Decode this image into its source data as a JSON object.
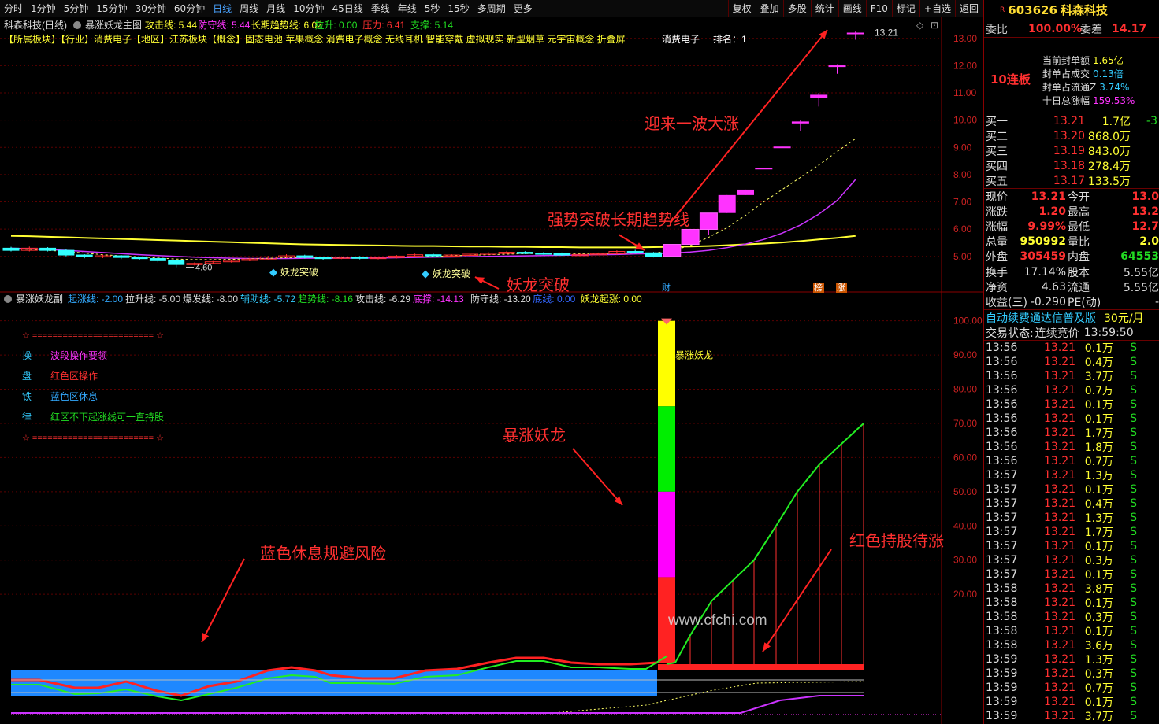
{
  "toolbar": {
    "items": [
      "分时",
      "1分钟",
      "5分钟",
      "15分钟",
      "30分钟",
      "60分钟",
      "日线",
      "周线",
      "月线",
      "10分钟",
      "45日线",
      "季线",
      "年线",
      "5秒",
      "15秒",
      "多周期",
      "更多"
    ],
    "active": "日线",
    "right": [
      "复权",
      "叠加",
      "多股",
      "统计",
      "画线",
      "F10",
      "标记",
      "+自选",
      "返回"
    ]
  },
  "main": {
    "header_name": "科森科技(日线)",
    "header_indicator": "暴涨妖龙主图",
    "params": [
      {
        "t": "攻击线: 5.44",
        "c": "#ffff33"
      },
      {
        "t": "防守线: 5.44",
        "c": "#ff33ff"
      },
      {
        "t": "长期趋势线: 6.02",
        "c": "#ffff33"
      },
      {
        "t": "拉升: 0.00",
        "c": "#22dd22"
      },
      {
        "t": "压力: 6.41",
        "c": "#ff3030"
      },
      {
        "t": "支撑: 5.14",
        "c": "#22dd22"
      }
    ],
    "concepts": "【所属板块】【行业】消费电子【地区】江苏板块【概念】固态电池 苹果概念 消费电子概念 无线耳机 智能穿戴 虚拟现实 新型烟草 元宇宙概念 折叠屏",
    "sector": "消费电子",
    "rank_label": "排名：1",
    "high_label": "13.21",
    "low_label": "4.60",
    "markers": [
      "财",
      "榜",
      "涨"
    ],
    "signals": [
      "妖龙突破",
      "妖龙突破"
    ],
    "annotations": [
      "迎来一波大涨",
      "强势突破长期趋势线",
      "妖龙突破"
    ]
  },
  "chart_data": [
    {
      "type": "candlestick",
      "title": "科森科技(日线)",
      "ylim": [
        4.3,
        13.6
      ],
      "yticks": [
        5.0,
        6.0,
        7.0,
        8.0,
        9.0,
        10.0,
        11.0,
        12.0,
        13.0
      ],
      "candles": [
        [
          5.3,
          5.22,
          5.35,
          5.18
        ],
        [
          5.22,
          5.3,
          5.36,
          5.18
        ],
        [
          5.3,
          5.22,
          5.34,
          5.18
        ],
        [
          5.22,
          5.05,
          5.26,
          5.0
        ],
        [
          5.05,
          4.98,
          5.08,
          4.93
        ],
        [
          4.98,
          5.02,
          5.06,
          4.94
        ],
        [
          5.02,
          4.96,
          5.05,
          4.9
        ],
        [
          4.96,
          4.92,
          4.99,
          4.86
        ],
        [
          4.92,
          4.84,
          4.95,
          4.78
        ],
        [
          4.84,
          4.7,
          4.88,
          4.6
        ],
        [
          4.7,
          4.74,
          4.78,
          4.66
        ],
        [
          4.74,
          4.8,
          4.83,
          4.71
        ],
        [
          4.8,
          4.85,
          4.88,
          4.77
        ],
        [
          4.85,
          4.9,
          4.94,
          4.82
        ],
        [
          4.9,
          4.98,
          5.02,
          4.88
        ],
        [
          4.98,
          5.02,
          5.08,
          4.94
        ],
        [
          5.02,
          4.96,
          5.06,
          4.92
        ],
        [
          4.96,
          4.94,
          4.99,
          4.88
        ],
        [
          4.94,
          4.97,
          5.0,
          4.9
        ],
        [
          4.97,
          4.93,
          5.01,
          4.89
        ],
        [
          4.93,
          4.96,
          4.99,
          4.89
        ],
        [
          4.96,
          5.01,
          5.05,
          4.92
        ],
        [
          5.01,
          5.06,
          5.1,
          4.98
        ],
        [
          5.06,
          5.02,
          5.1,
          4.98
        ],
        [
          5.02,
          5.05,
          5.08,
          4.98
        ],
        [
          5.05,
          5.08,
          5.12,
          5.02
        ],
        [
          5.08,
          5.12,
          5.16,
          5.04
        ],
        [
          5.12,
          5.15,
          5.2,
          5.08
        ],
        [
          5.15,
          5.12,
          5.19,
          5.08
        ],
        [
          5.12,
          5.1,
          5.15,
          5.06
        ],
        [
          5.1,
          5.05,
          5.14,
          5.02
        ],
        [
          5.05,
          5.07,
          5.1,
          5.02
        ],
        [
          5.07,
          5.1,
          5.14,
          5.04
        ],
        [
          5.1,
          5.18,
          5.22,
          5.06
        ],
        [
          5.18,
          5.13,
          5.24,
          5.1
        ],
        [
          5.13,
          5.0,
          5.16,
          4.96
        ],
        [
          5.0,
          5.44,
          5.44,
          4.98
        ],
        [
          5.44,
          5.99,
          5.99,
          5.44
        ],
        [
          5.99,
          6.59,
          6.59,
          5.8
        ],
        [
          6.59,
          7.25,
          7.25,
          6.59
        ],
        [
          7.25,
          7.45,
          7.45,
          7.25
        ],
        [
          8.2,
          8.25,
          8.25,
          8.2
        ],
        [
          8.99,
          9.03,
          9.03,
          8.99
        ],
        [
          9.88,
          9.95,
          10.0,
          9.6
        ],
        [
          10.8,
          10.93,
          11.0,
          10.5
        ],
        [
          11.95,
          12.01,
          12.05,
          11.7
        ],
        [
          13.21,
          13.21,
          13.25,
          12.95
        ]
      ],
      "series": [
        {
          "name": "长期趋势线",
          "value": 6.02
        },
        {
          "name": "攻击线",
          "value": 5.44
        },
        {
          "name": "防守线",
          "value": 5.44
        }
      ]
    },
    {
      "type": "indicator",
      "title": "暴涨妖龙副",
      "ylim": [
        0,
        102
      ],
      "yticks": [
        20,
        30,
        40,
        50,
        60,
        70,
        80,
        90,
        100
      ],
      "params": [
        {
          "t": "起涨线: -2.00",
          "c": "#33aaff"
        },
        {
          "t": "拉升线: -5.00",
          "c": "#ddd"
        },
        {
          "t": "爆发线: -8.00",
          "c": "#ddd"
        },
        {
          "t": "辅助线: -5.72",
          "c": "#33ccff"
        },
        {
          "t": "趋势线: -8.16",
          "c": "#22dd22"
        },
        {
          "t": "攻击线: -6.29",
          "c": "#ddd"
        },
        {
          "t": "底撑: -14.13",
          "c": "#ff33ff"
        },
        {
          "t": "防守线: -13.20",
          "c": "#ddd"
        },
        {
          "t": "底线: 0.00",
          "c": "#3366ff"
        },
        {
          "t": "妖龙起涨: 0.00",
          "c": "#ffff33"
        }
      ],
      "values": [
        0,
        0,
        0,
        0,
        0,
        0,
        0,
        0,
        0,
        0,
        0,
        0,
        0,
        0,
        0,
        0,
        0,
        0,
        0,
        0,
        0,
        0,
        0,
        0,
        0,
        0,
        0,
        0,
        0,
        0,
        0,
        0,
        0,
        0,
        0,
        100,
        8,
        18,
        30,
        40,
        50,
        58,
        64,
        70
      ],
      "legend_rows": [
        {
          "k": "操",
          "v": "波段操作要领"
        },
        {
          "k": "盘",
          "v": "红色区操作"
        },
        {
          "k": "铁",
          "v": "蓝色区休息"
        },
        {
          "k": "律",
          "v": "红区不下起涨线可一直持股"
        }
      ],
      "stars": "☆ ======================== ☆",
      "bar_label": "暴涨妖龙",
      "annotations": [
        "暴涨妖龙",
        "蓝色休息规避风险",
        "红色持股待涨"
      ],
      "watermark": "www.cfchi.com"
    }
  ],
  "quote": {
    "code": "603626",
    "name": "科森科技",
    "weibi_label": "委比",
    "weibi": "100.00%",
    "weicha_label": "委差",
    "weicha": "14.17",
    "lianban": "10连板",
    "seal": [
      {
        "l": "当前封单额",
        "v": "1.65亿",
        "c": "#ffff33"
      },
      {
        "l": "封单占成交",
        "v": "0.13倍",
        "c": "#33ccff"
      },
      {
        "l": "封单占流通Z",
        "v": "3.74%",
        "c": "#33ccff"
      },
      {
        "l": "十日总涨幅",
        "v": "159.53%",
        "c": "#ff33ff"
      }
    ],
    "book": [
      {
        "l": "买一",
        "p": "13.21",
        "v": "1.7亿",
        "x": "-3"
      },
      {
        "l": "买二",
        "p": "13.20",
        "v": "868.0万",
        "x": ""
      },
      {
        "l": "买三",
        "p": "13.19",
        "v": "843.0万",
        "x": ""
      },
      {
        "l": "买四",
        "p": "13.18",
        "v": "278.4万",
        "x": ""
      },
      {
        "l": "买五",
        "p": "13.17",
        "v": "133.5万",
        "x": ""
      }
    ],
    "stats": [
      {
        "a": "现价",
        "av": "13.21",
        "ac": "#ff3030",
        "b": "今开",
        "bv": "13.0",
        "bc": "#ff3030"
      },
      {
        "a": "涨跌",
        "av": "1.20",
        "ac": "#ff3030",
        "b": "最高",
        "bv": "13.2",
        "bc": "#ff3030"
      },
      {
        "a": "涨幅",
        "av": "9.99%",
        "ac": "#ff3030",
        "b": "最低",
        "bv": "12.7",
        "bc": "#ff3030"
      },
      {
        "a": "总量",
        "av": "950992",
        "ac": "#ffff33",
        "b": "量比",
        "bv": "2.0",
        "bc": "#ffff33"
      },
      {
        "a": "外盘",
        "av": "305459",
        "ac": "#ff3030",
        "b": "内盘",
        "bv": "64553",
        "bc": "#22dd22"
      }
    ],
    "stats2": [
      {
        "a": "换手",
        "av": "17.14%",
        "b": "股本",
        "bv": "5.55亿"
      },
      {
        "a": "净资",
        "av": "4.63",
        "b": "流通",
        "bv": "5.55亿"
      },
      {
        "a": "收益(三)",
        "av": "-0.290",
        "b": "PE(动)",
        "bv": "-"
      }
    ],
    "ad": "自动续费通达信普及版",
    "ad_price": "30元/月",
    "status_label": "交易状态:",
    "status": "连续竞价",
    "status_time": "13:59:50",
    "ticks": [
      [
        "13:56",
        "13.21",
        "0.1万",
        "S"
      ],
      [
        "13:56",
        "13.21",
        "0.4万",
        "S"
      ],
      [
        "13:56",
        "13.21",
        "3.7万",
        "S"
      ],
      [
        "13:56",
        "13.21",
        "0.7万",
        "S"
      ],
      [
        "13:56",
        "13.21",
        "0.1万",
        "S"
      ],
      [
        "13:56",
        "13.21",
        "0.1万",
        "S"
      ],
      [
        "13:56",
        "13.21",
        "1.7万",
        "S"
      ],
      [
        "13:56",
        "13.21",
        "1.8万",
        "S"
      ],
      [
        "13:56",
        "13.21",
        "0.7万",
        "S"
      ],
      [
        "13:57",
        "13.21",
        "1.3万",
        "S"
      ],
      [
        "13:57",
        "13.21",
        "0.1万",
        "S"
      ],
      [
        "13:57",
        "13.21",
        "0.4万",
        "S"
      ],
      [
        "13:57",
        "13.21",
        "1.3万",
        "S"
      ],
      [
        "13:57",
        "13.21",
        "1.7万",
        "S"
      ],
      [
        "13:57",
        "13.21",
        "0.1万",
        "S"
      ],
      [
        "13:57",
        "13.21",
        "0.3万",
        "S"
      ],
      [
        "13:57",
        "13.21",
        "0.1万",
        "S"
      ],
      [
        "13:58",
        "13.21",
        "3.8万",
        "S"
      ],
      [
        "13:58",
        "13.21",
        "0.1万",
        "S"
      ],
      [
        "13:58",
        "13.21",
        "0.3万",
        "S"
      ],
      [
        "13:58",
        "13.21",
        "0.1万",
        "S"
      ],
      [
        "13:58",
        "13.21",
        "3.6万",
        "S"
      ],
      [
        "13:59",
        "13.21",
        "1.3万",
        "S"
      ],
      [
        "13:59",
        "13.21",
        "0.3万",
        "S"
      ],
      [
        "13:59",
        "13.21",
        "0.7万",
        "S"
      ],
      [
        "13:59",
        "13.21",
        "0.1万",
        "S"
      ],
      [
        "13:59",
        "13.21",
        "3.7万",
        "S"
      ]
    ]
  }
}
